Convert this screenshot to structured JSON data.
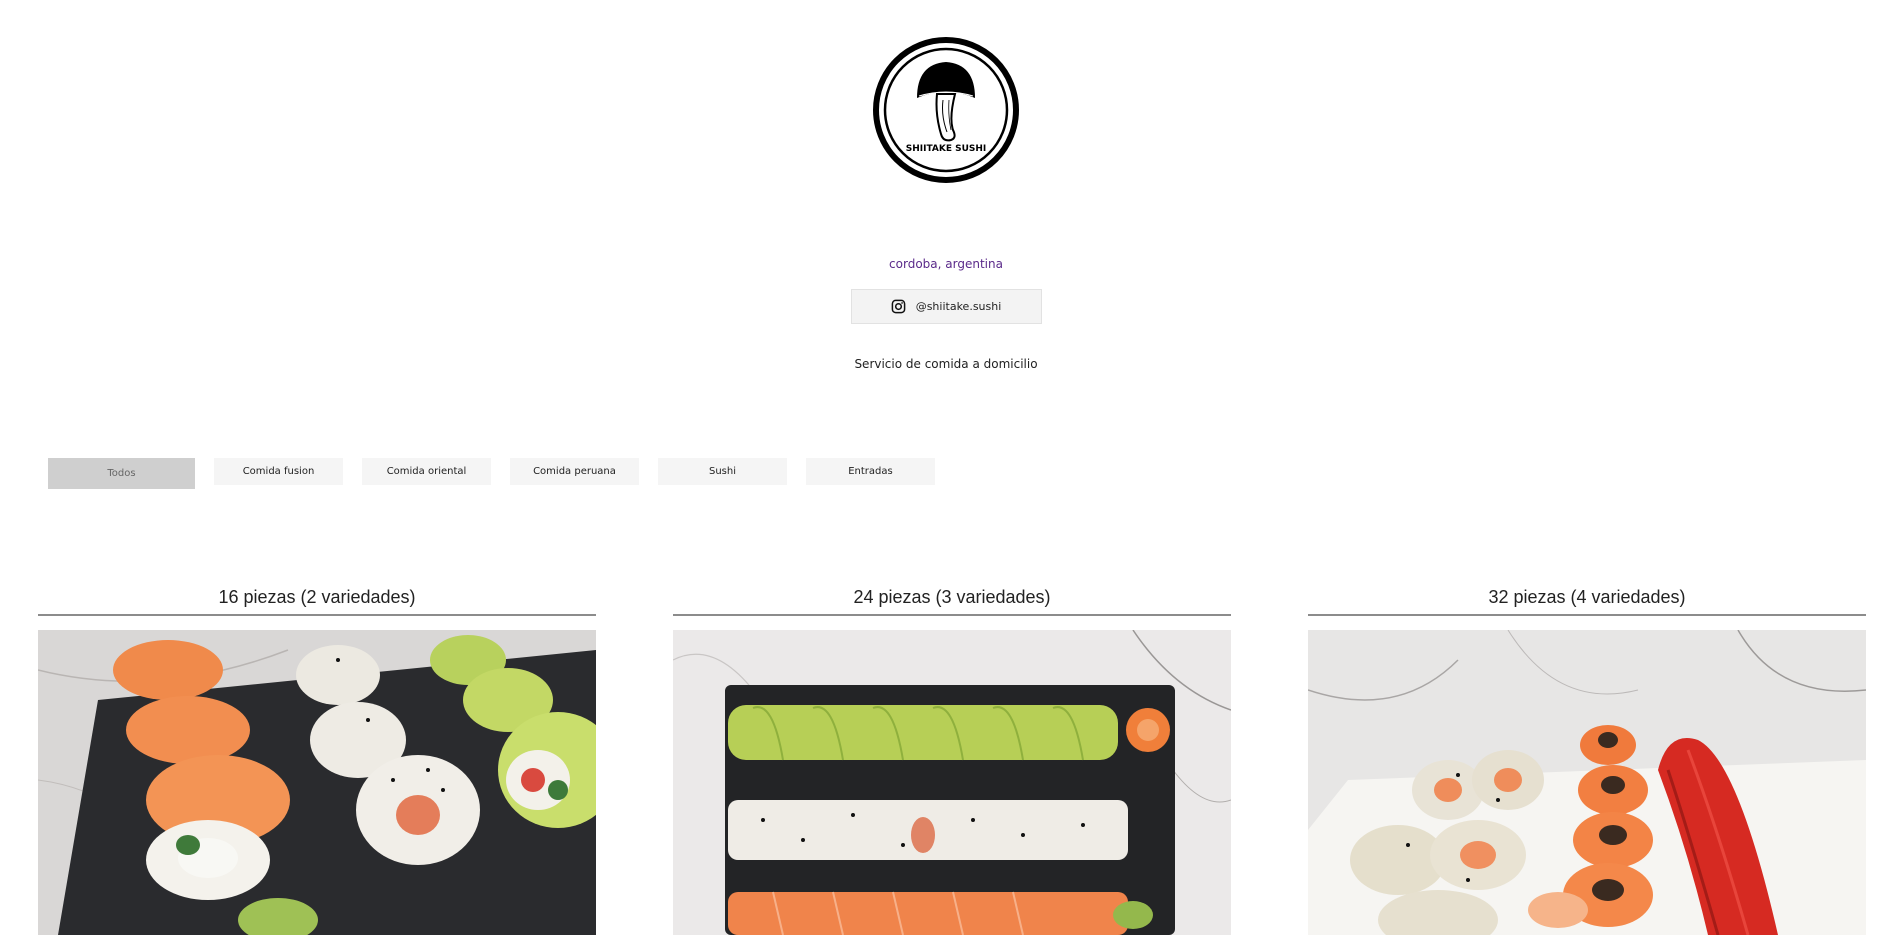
{
  "brand": {
    "logo_text": "SHIITAKE SUSHI",
    "location": "cordoba, argentina",
    "instagram": "@shiitake.sushi",
    "tagline": "Servicio de comida a domicilio"
  },
  "filters": [
    {
      "label": "Todos",
      "active": true
    },
    {
      "label": "Comida fusion",
      "active": false
    },
    {
      "label": "Comida oriental",
      "active": false
    },
    {
      "label": "Comida peruana",
      "active": false
    },
    {
      "label": "Sushi",
      "active": false
    },
    {
      "label": "Entradas",
      "active": false
    }
  ],
  "products": [
    {
      "title": "16 piezas (2 variedades)"
    },
    {
      "title": "24 piezas (3 variedades)"
    },
    {
      "title": "32 piezas (4 variedades)"
    }
  ],
  "colors": {
    "location_link": "#5a2a8a",
    "active_filter": "#cfcfcf",
    "filter_bg": "#f5f5f5",
    "divider": "#8c8c8c"
  }
}
